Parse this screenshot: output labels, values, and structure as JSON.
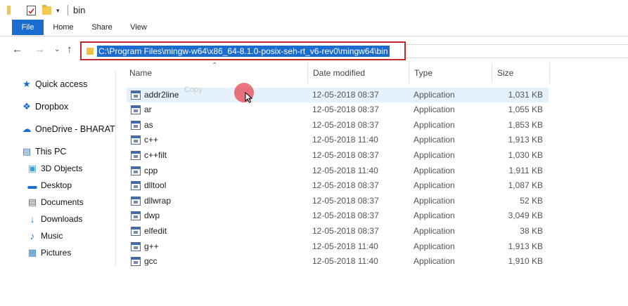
{
  "window": {
    "title": "bin"
  },
  "ribbon": {
    "tabs": [
      {
        "label": "File"
      },
      {
        "label": "Home"
      },
      {
        "label": "Share"
      },
      {
        "label": "View"
      }
    ]
  },
  "address_bar": {
    "path": "C:\\Program Files\\mingw-w64\\x86_64-8.1.0-posix-seh-rt_v6-rev0\\mingw64\\bin"
  },
  "nav_pane": {
    "items": [
      {
        "label": "Quick access",
        "icon": "star-icon"
      },
      {
        "label": "Dropbox",
        "icon": "dropbox-icon"
      },
      {
        "label": "OneDrive - BHARATI",
        "icon": "cloud-icon"
      },
      {
        "label": "This PC",
        "icon": "computer-icon"
      },
      {
        "label": "3D Objects",
        "icon": "cube-icon"
      },
      {
        "label": "Desktop",
        "icon": "desktop-icon"
      },
      {
        "label": "Documents",
        "icon": "document-icon"
      },
      {
        "label": "Downloads",
        "icon": "download-icon"
      },
      {
        "label": "Music",
        "icon": "music-icon"
      },
      {
        "label": "Pictures",
        "icon": "picture-icon"
      }
    ]
  },
  "file_list": {
    "columns": [
      "Name",
      "Date modified",
      "Type",
      "Size"
    ],
    "drag_hint": "Copy",
    "rows": [
      {
        "name": "addr2line",
        "date": "12-05-2018 08:37",
        "type": "Application",
        "size": "1,031 KB"
      },
      {
        "name": "ar",
        "date": "12-05-2018 08:37",
        "type": "Application",
        "size": "1,055 KB"
      },
      {
        "name": "as",
        "date": "12-05-2018 08:37",
        "type": "Application",
        "size": "1,853 KB"
      },
      {
        "name": "c++",
        "date": "12-05-2018 11:40",
        "type": "Application",
        "size": "1,913 KB"
      },
      {
        "name": "c++filt",
        "date": "12-05-2018 08:37",
        "type": "Application",
        "size": "1,030 KB"
      },
      {
        "name": "cpp",
        "date": "12-05-2018 11:40",
        "type": "Application",
        "size": "1,911 KB"
      },
      {
        "name": "dlltool",
        "date": "12-05-2018 08:37",
        "type": "Application",
        "size": "1,087 KB"
      },
      {
        "name": "dllwrap",
        "date": "12-05-2018 08:37",
        "type": "Application",
        "size": "52 KB"
      },
      {
        "name": "dwp",
        "date": "12-05-2018 08:37",
        "type": "Application",
        "size": "3,049 KB"
      },
      {
        "name": "elfedit",
        "date": "12-05-2018 08:37",
        "type": "Application",
        "size": "38 KB"
      },
      {
        "name": "g++",
        "date": "12-05-2018 11:40",
        "type": "Application",
        "size": "1,913 KB"
      },
      {
        "name": "gcc",
        "date": "12-05-2018 11:40",
        "type": "Application",
        "size": "1,910 KB"
      }
    ]
  },
  "colors": {
    "accent": "#1a6ccf",
    "highlight_border": "#c0262c",
    "row_selected": "#e5f1fb"
  }
}
